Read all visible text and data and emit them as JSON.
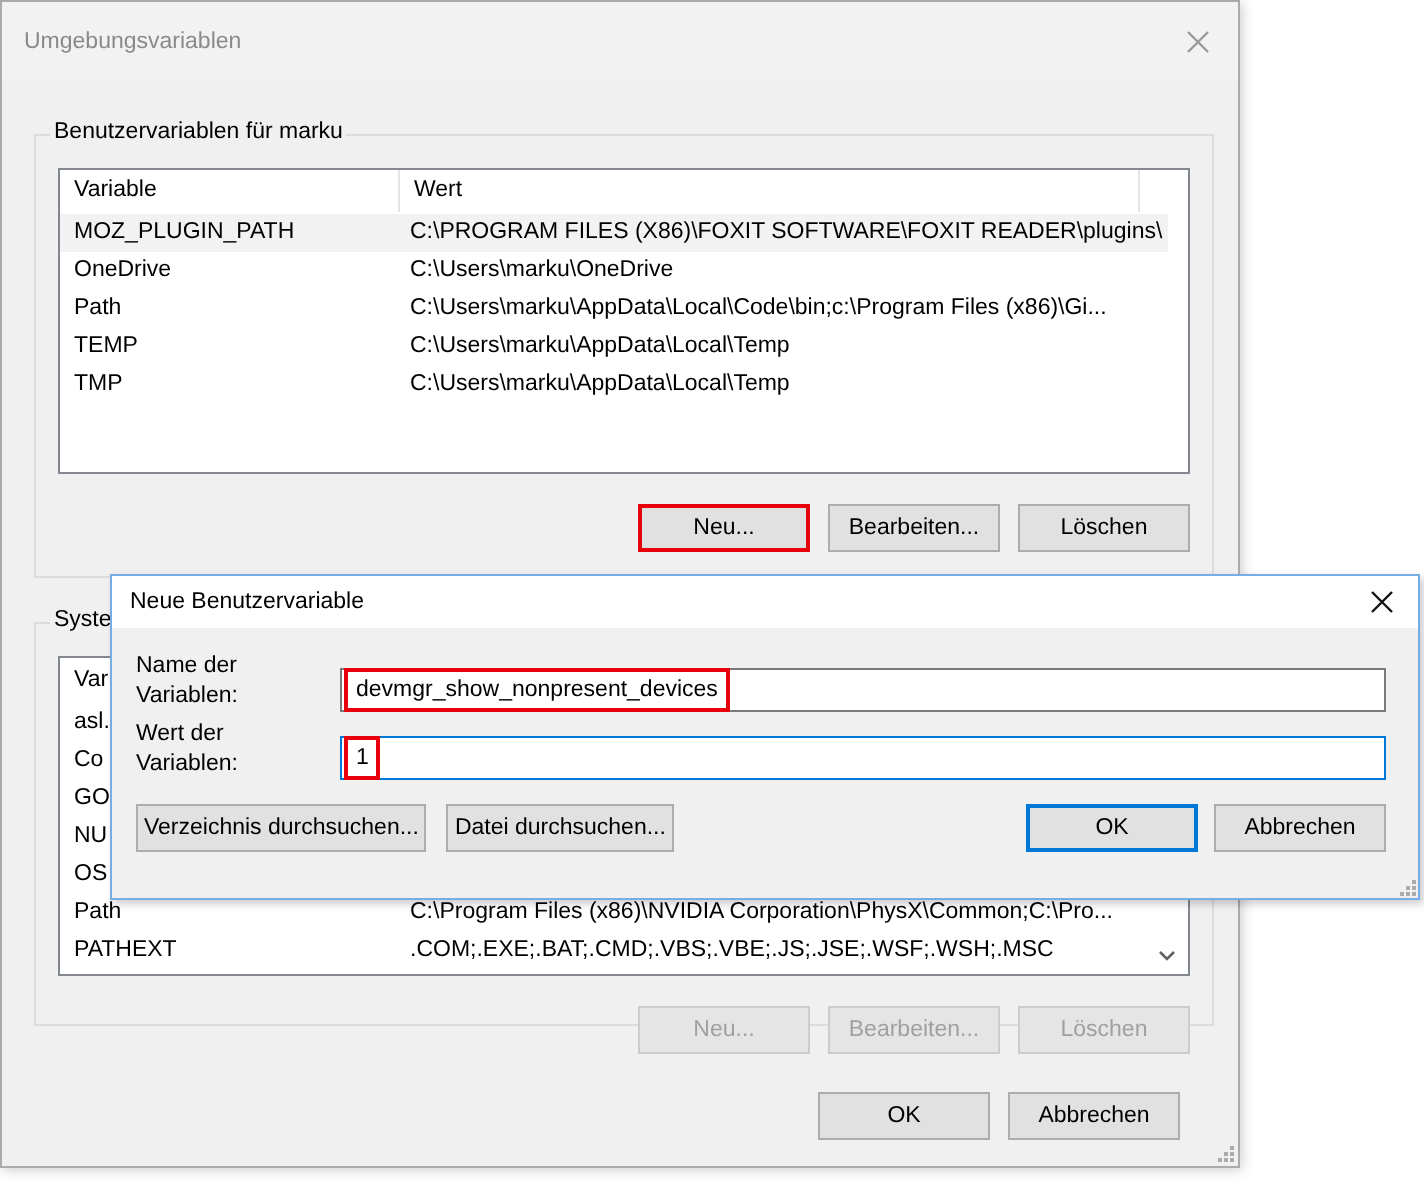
{
  "main_window": {
    "title": "Umgebungsvariablen",
    "user_group": {
      "title": "Benutzervariablen für marku",
      "columns": [
        "Variable",
        "Wert"
      ],
      "rows": [
        {
          "variable": "MOZ_PLUGIN_PATH",
          "value": "C:\\PROGRAM FILES (X86)\\FOXIT SOFTWARE\\FOXIT READER\\plugins\\",
          "selected": true
        },
        {
          "variable": "OneDrive",
          "value": "C:\\Users\\marku\\OneDrive",
          "selected": false
        },
        {
          "variable": "Path",
          "value": "C:\\Users\\marku\\AppData\\Local\\Code\\bin;c:\\Program Files (x86)\\Gi...",
          "selected": false
        },
        {
          "variable": "TEMP",
          "value": "C:\\Users\\marku\\AppData\\Local\\Temp",
          "selected": false
        },
        {
          "variable": "TMP",
          "value": "C:\\Users\\marku\\AppData\\Local\\Temp",
          "selected": false
        }
      ],
      "buttons": [
        {
          "label": "Neu...",
          "disabled": false,
          "highlighted": true
        },
        {
          "label": "Bearbeiten...",
          "disabled": false,
          "highlighted": false
        },
        {
          "label": "Löschen",
          "disabled": false,
          "highlighted": false
        }
      ]
    },
    "system_group": {
      "title": "Syste",
      "columns": [
        "Var"
      ],
      "rows": [
        {
          "variable": "asl.",
          "selected": false
        },
        {
          "variable": "Co",
          "selected": false
        },
        {
          "variable": "GO",
          "selected": false
        },
        {
          "variable": "NU",
          "selected": false
        },
        {
          "variable": "OS",
          "selected": false
        },
        {
          "variable": "Path",
          "value": "C:\\Program Files (x86)\\NVIDIA Corporation\\PhysX\\Common;C:\\Pro...",
          "selected": false
        },
        {
          "variable": "PATHEXT",
          "value": ".COM;.EXE;.BAT;.CMD;.VBS;.VBE;.JS;.JSE;.WSF;.WSH;.MSC",
          "selected": false
        }
      ],
      "buttons": [
        {
          "label": "Neu...",
          "disabled": true,
          "highlighted": false
        },
        {
          "label": "Bearbeiten...",
          "disabled": true,
          "highlighted": false
        },
        {
          "label": "Löschen",
          "disabled": true,
          "highlighted": false
        }
      ]
    },
    "buttons": [
      {
        "label": "OK",
        "disabled": false,
        "highlighted": false
      },
      {
        "label": "Abbrechen",
        "disabled": false,
        "highlighted": false
      }
    ]
  },
  "dialog": {
    "title": "Neue Benutzervariable",
    "fields": [
      {
        "label": "Name der Variablen:",
        "value": "devmgr_show_nonpresent_devices",
        "focused": false,
        "highlighted": true
      },
      {
        "label": "Wert der Variablen:",
        "value": "1",
        "focused": true,
        "highlighted": true
      }
    ],
    "left_buttons": [
      {
        "label": "Verzeichnis durchsuchen...",
        "default": false
      },
      {
        "label": "Datei durchsuchen...",
        "default": false
      }
    ],
    "right_buttons": [
      {
        "label": "OK",
        "default": true
      },
      {
        "label": "Abbrechen",
        "default": false
      }
    ]
  }
}
